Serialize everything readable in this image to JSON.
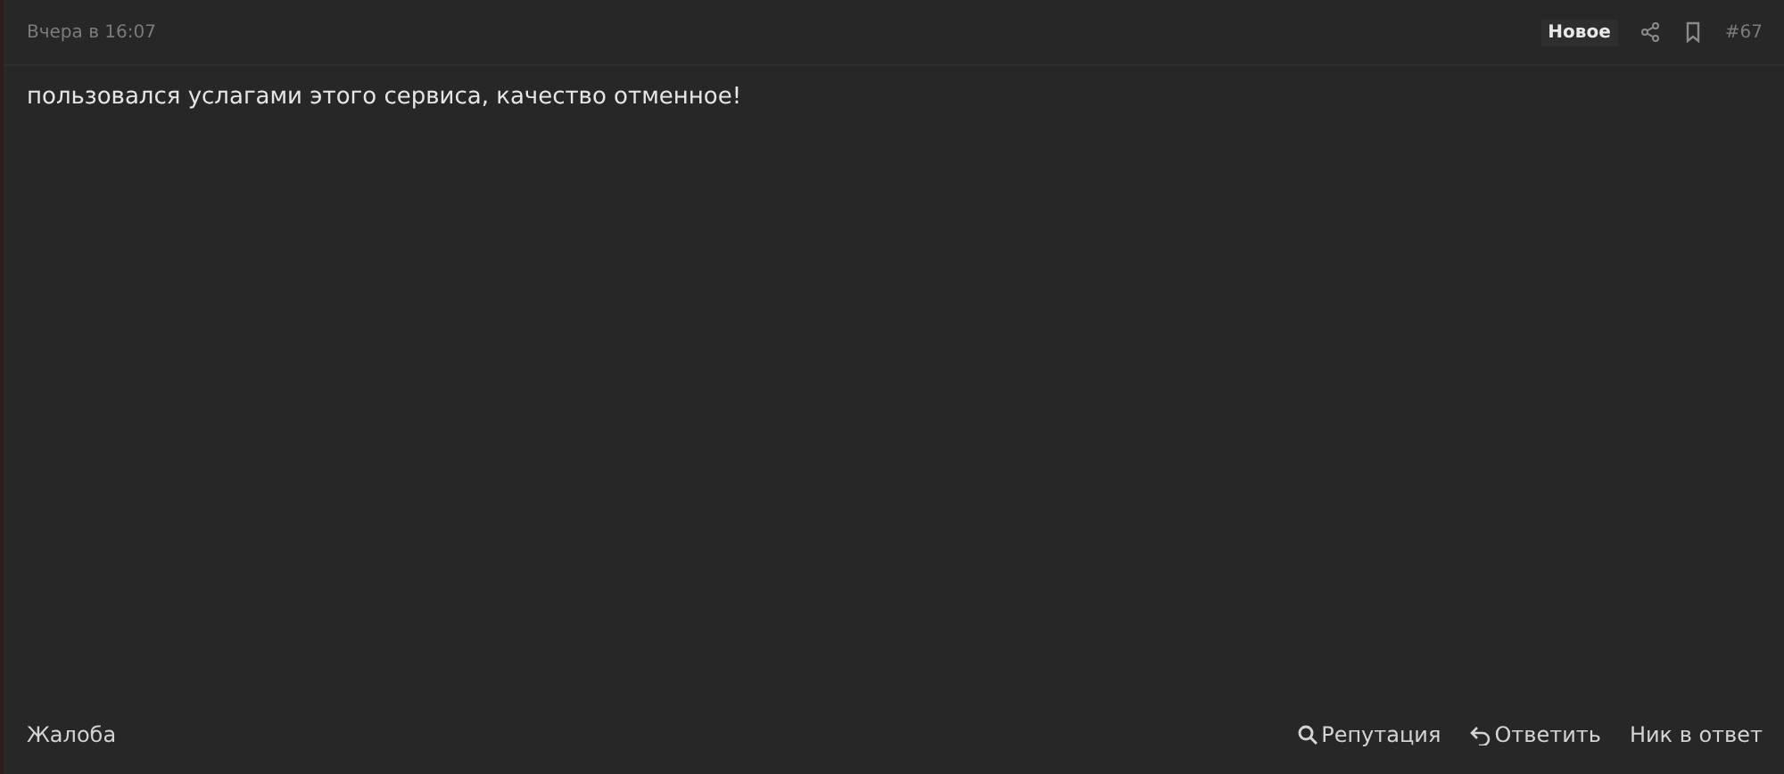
{
  "post": {
    "date": "Вчера в 16:07",
    "badge": "Новое",
    "number": "#67",
    "body": "пользовался услагами этого сервиса, качество отменное!"
  },
  "footer": {
    "report": "Жалоба",
    "actions": [
      {
        "kind": "reputation",
        "label": "Репутация"
      },
      {
        "kind": "reply",
        "label": "Ответить"
      },
      {
        "kind": "plain",
        "label": "Ник в ответ"
      }
    ]
  }
}
